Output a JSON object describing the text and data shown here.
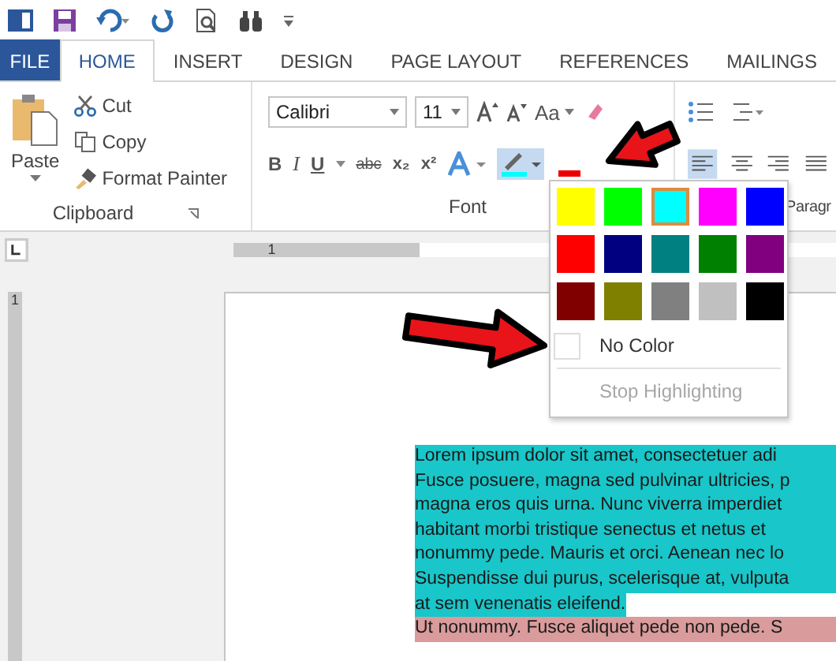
{
  "ribbon_tabs": [
    {
      "label": "FILE",
      "kind": "file",
      "selected": false
    },
    {
      "label": "HOME",
      "kind": "tab",
      "selected": true
    },
    {
      "label": "INSERT",
      "kind": "tab",
      "selected": false
    },
    {
      "label": "DESIGN",
      "kind": "tab",
      "selected": false
    },
    {
      "label": "PAGE LAYOUT",
      "kind": "tab",
      "selected": false
    },
    {
      "label": "REFERENCES",
      "kind": "tab",
      "selected": false
    },
    {
      "label": "MAILINGS",
      "kind": "tab",
      "selected": false
    }
  ],
  "clipboard": {
    "paste": "Paste",
    "cut": "Cut",
    "copy": "Copy",
    "format_painter": "Format Painter",
    "group_label": "Clipboard"
  },
  "font": {
    "font_name": "Calibri",
    "font_size": "11",
    "change_case": "Aa",
    "bold": "B",
    "italic": "I",
    "underline": "U",
    "strikethrough": "abc",
    "subscript": "x₂",
    "superscript": "x²",
    "group_label": "Font"
  },
  "paragraph": {
    "group_label": "Paragr"
  },
  "highlight_menu": {
    "swatches": [
      {
        "color": "#ffff00",
        "selected": false
      },
      {
        "color": "#00ff00",
        "selected": false
      },
      {
        "color": "#00ffff",
        "selected": true
      },
      {
        "color": "#ff00ff",
        "selected": false
      },
      {
        "color": "#0000ff",
        "selected": false
      },
      {
        "color": "#ff0000",
        "selected": false
      },
      {
        "color": "#000080",
        "selected": false
      },
      {
        "color": "#008080",
        "selected": false
      },
      {
        "color": "#008000",
        "selected": false
      },
      {
        "color": "#800080",
        "selected": false
      },
      {
        "color": "#800000",
        "selected": false
      },
      {
        "color": "#808000",
        "selected": false
      },
      {
        "color": "#808080",
        "selected": false
      },
      {
        "color": "#c0c0c0",
        "selected": false
      },
      {
        "color": "#000000",
        "selected": false
      }
    ],
    "no_color": "No Color",
    "stop_highlighting": {
      "label": "Stop Highlighting",
      "disabled": true
    }
  },
  "ruler": {
    "horizontal_mark": "1",
    "vertical_mark": "1"
  },
  "document_lines": [
    {
      "text": "Lorem ipsum dolor sit amet, consectetuer adi",
      "color": "#19c6c9",
      "full": true
    },
    {
      "text": "Fusce posuere, magna sed pulvinar ultricies, p",
      "color": "#19c6c9",
      "full": true
    },
    {
      "text": "magna eros quis urna. Nunc viverra imperdiet",
      "color": "#19c6c9",
      "full": true
    },
    {
      "text": "habitant morbi tristique senectus et netus et",
      "color": "#19c6c9",
      "full": true
    },
    {
      "text": "nonummy pede. Mauris et orci. Aenean nec lo",
      "color": "#19c6c9",
      "full": true
    },
    {
      "text": "Suspendisse dui purus, scelerisque at, vulputa",
      "color": "#19c6c9",
      "full": true
    },
    {
      "text": "at sem venenatis eleifend.",
      "color": "#19c6c9",
      "full": false
    },
    {
      "text": "Ut nonummy. Fusce aliquet pede non pede. S",
      "color": "#d99b9b",
      "full": true
    }
  ]
}
